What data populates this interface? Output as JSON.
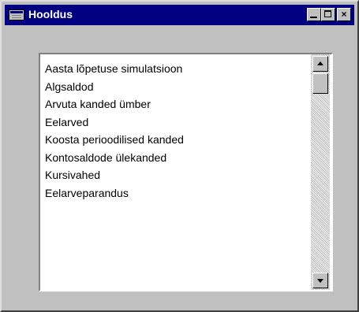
{
  "window": {
    "title": "Hooldus",
    "controls": {
      "minimize": "",
      "maximize": "",
      "close": "×"
    }
  },
  "list": {
    "items": [
      "Aasta lõpetuse simulatsioon",
      "Algsaldod",
      "Arvuta kanded ümber",
      "Eelarved",
      "Koosta perioodilised kanded",
      "Kontosaldode ülekanded",
      "Kursivahed",
      "Eelarveparandus"
    ]
  },
  "colors": {
    "titlebar": "#000080",
    "face": "#c0c0c0",
    "list_background": "#ffffff"
  },
  "icons": [
    "window-icon",
    "minimize-icon",
    "maximize-icon",
    "close-icon",
    "scroll-up-arrow-icon",
    "scroll-down-arrow-icon"
  ]
}
